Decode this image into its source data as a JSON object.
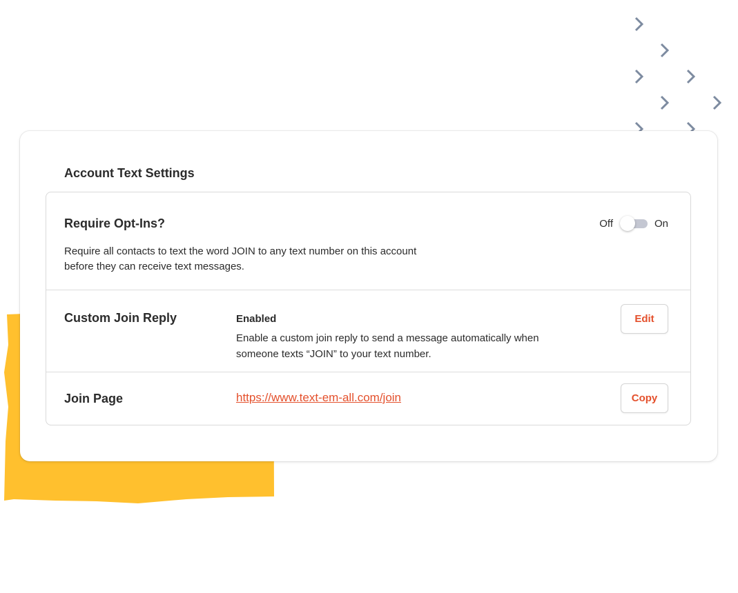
{
  "card": {
    "title": "Account Text Settings"
  },
  "opt_ins": {
    "title": "Require Opt-Ins?",
    "description": "Require all contacts to text the word JOIN to any text number on this account before they can receive text messages.",
    "toggle_off_label": "Off",
    "toggle_on_label": "On",
    "toggle_state": "off"
  },
  "custom_join_reply": {
    "title": "Custom Join Reply",
    "status": "Enabled",
    "description": "Enable a custom join reply to send a message automatically when someone texts “JOIN” to your text number.",
    "edit_label": "Edit"
  },
  "join_page": {
    "title": "Join Page",
    "url": "https://www.text-em-all.com/join",
    "copy_label": "Copy"
  },
  "colors": {
    "accent": "#e4502c",
    "decor_yellow": "#ffc02e",
    "decor_chevron": "#7d8ba0",
    "toggle_track": "#c4c7d2"
  },
  "icons": [
    "chevron-right-icon"
  ]
}
